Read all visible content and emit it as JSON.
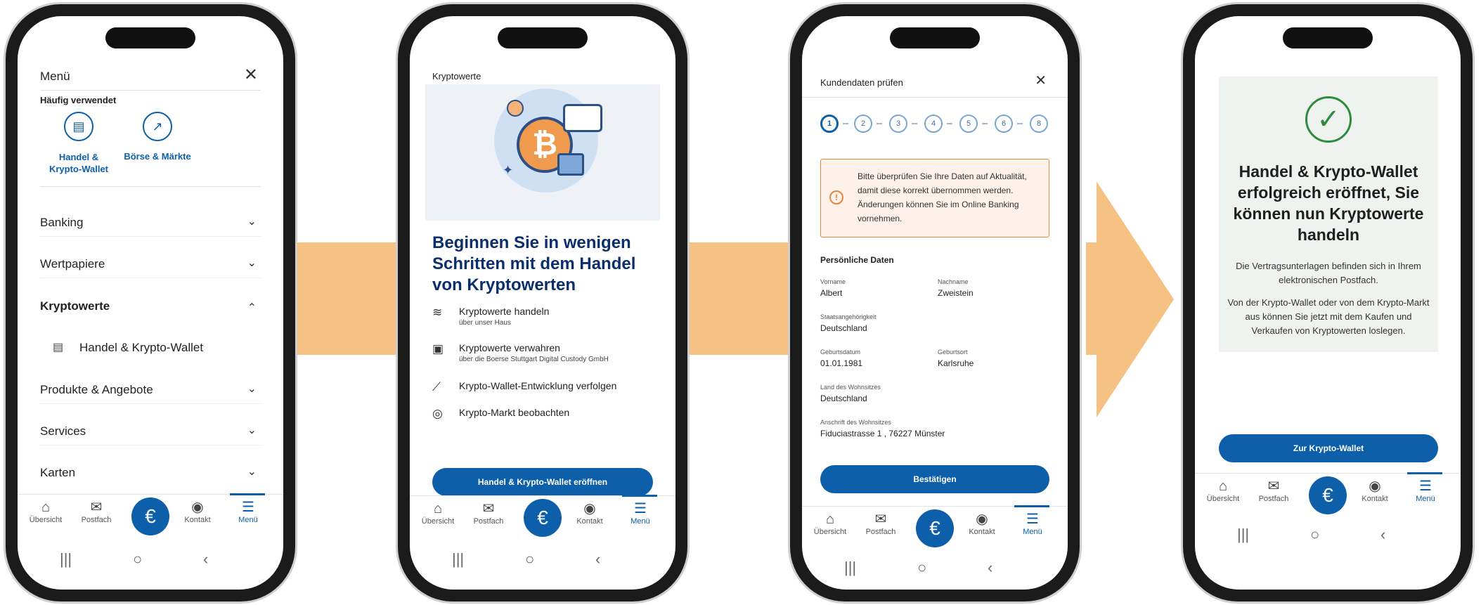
{
  "screens": {
    "menu": {
      "title": "Menü",
      "section_frequent": "Häufig verwendet",
      "quick_links": [
        {
          "label_line1": "Handel &",
          "label_line2": "Krypto-Wallet",
          "icon": "wallet-icon"
        },
        {
          "label_line1": "Börse & Märkte",
          "icon": "chart-icon"
        }
      ],
      "items": [
        {
          "label": "Banking"
        },
        {
          "label": "Wertpapiere"
        },
        {
          "label": "Kryptowerte"
        },
        {
          "label": "Handel & Krypto-Wallet"
        },
        {
          "label": "Produkte & Angebote"
        },
        {
          "label": "Services"
        },
        {
          "label": "Karten"
        }
      ]
    },
    "crypto": {
      "title": "Kryptowerte",
      "headline": "Beginnen Sie in wenigen Schritten mit dem Handel von Kryptowerten",
      "features": [
        {
          "title": "Kryptowerte handeln",
          "subtitle": "über unser Haus",
          "icon": "hand-coin-icon"
        },
        {
          "title": "Kryptowerte verwahren",
          "subtitle": "über die Boerse Stuttgart Digital Custody GmbH",
          "icon": "wallet-icon"
        },
        {
          "title": "Krypto-Wallet-Entwicklung verfolgen",
          "subtitle": "",
          "icon": "trend-icon"
        },
        {
          "title": "Krypto-Markt beobachten",
          "subtitle": "",
          "icon": "eye-icon"
        }
      ],
      "cta": "Handel & Krypto-Wallet eröffnen"
    },
    "customer": {
      "title": "Kundendaten prüfen",
      "steps": [
        "1",
        "2",
        "3",
        "4",
        "5",
        "6",
        "8"
      ],
      "notice": "Bitte überprüfen Sie Ihre Daten auf Aktualität, damit diese korrekt übernommen werden. Änderungen können Sie im Online Banking vornehmen.",
      "section": "Persönliche Daten",
      "fields": {
        "first_name_label": "Vorname",
        "first_name": "Albert",
        "last_name_label": "Nachname",
        "last_name": "Zweistein",
        "nationality_label": "Staatsangehörigkeit",
        "nationality": "Deutschland",
        "dob_label": "Geburtsdatum",
        "dob": "01.01.1981",
        "pob_label": "Geburtsort",
        "pob": "Karlsruhe",
        "country_label": "Land des Wohnsitzes",
        "country": "Deutschland",
        "address_label": "Anschrift des Wohnsitzes",
        "address": "Fiduciastrasse 1 , 76227 Münster"
      },
      "cta": "Bestätigen"
    },
    "success": {
      "headline": "Handel & Krypto-Wallet erfolgreich eröffnet, Sie können nun Kryptowerte handeln",
      "text1": "Die Vertragsunterlagen befinden sich in Ihrem elektronischen Postfach.",
      "text2": "Von der Krypto-Wallet oder von dem Krypto-Markt aus können Sie jetzt mit dem Kaufen und Verkaufen von Kryptowerten loslegen.",
      "cta": "Zur Krypto-Wallet"
    }
  },
  "bottom_nav": {
    "items": [
      {
        "label": "Übersicht",
        "icon": "home-icon"
      },
      {
        "label": "Postfach",
        "icon": "mail-icon"
      },
      {
        "label": "Kontakt",
        "icon": "contact-icon"
      },
      {
        "label": "Menü",
        "icon": "menu-icon"
      }
    ],
    "center_symbol": "€"
  },
  "colors": {
    "primary": "#0c5fa8",
    "arrow": "#f6c283",
    "warning": "#e5873a",
    "success": "#2e8b3e",
    "headline": "#0b2f6b"
  }
}
